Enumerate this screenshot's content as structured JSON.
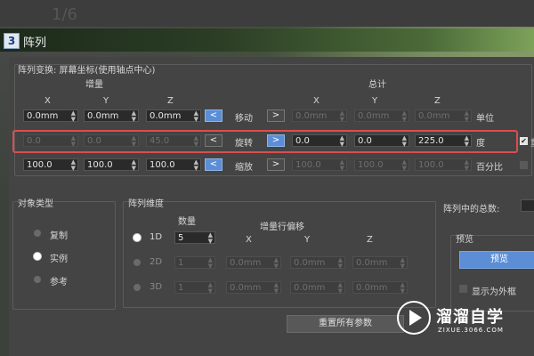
{
  "top": {
    "page_num": "1/6"
  },
  "window": {
    "icon_text": "3",
    "title": "阵列"
  },
  "transform": {
    "group_label": "阵列变换: 屏幕坐标(使用轴点中心)",
    "increment_label": "增量",
    "total_label": "总计",
    "axes": [
      "X",
      "Y",
      "Z"
    ],
    "rows": [
      {
        "name": "move",
        "label": "移动",
        "unit": "单位",
        "inc": [
          "0.0mm",
          "0.0mm",
          "0.0mm"
        ],
        "inc_enabled": true,
        "left_active": true,
        "right_active": false,
        "total": [
          "0.0mm",
          "0.0mm",
          "0.0mm"
        ],
        "total_enabled": false,
        "btn_left": "<",
        "btn_right": ">"
      },
      {
        "name": "rotate",
        "label": "旋转",
        "unit": "度",
        "check_label": "重",
        "inc": [
          "0.0",
          "0.0",
          "45.0"
        ],
        "inc_enabled": false,
        "left_active": false,
        "right_active": true,
        "total": [
          "0.0",
          "0.0",
          "225.0"
        ],
        "total_enabled": true,
        "btn_left": "<",
        "btn_right": ">"
      },
      {
        "name": "scale",
        "label": "缩放",
        "unit": "百分比",
        "inc": [
          "100.0",
          "100.0",
          "100.0"
        ],
        "inc_enabled": true,
        "left_active": true,
        "right_active": false,
        "total": [
          "100.0",
          "100.0",
          "100.0"
        ],
        "total_enabled": false,
        "btn_left": "<",
        "btn_right": ">"
      }
    ]
  },
  "object_type": {
    "label": "对象类型",
    "options": [
      "复制",
      "实例",
      "参考"
    ],
    "selected": 1
  },
  "dimensions": {
    "label": "阵列维度",
    "count_label": "数量",
    "offset_label": "增量行偏移",
    "axes": [
      "X",
      "Y",
      "Z"
    ],
    "rows": [
      {
        "label": "1D",
        "count": "5",
        "enabled": true,
        "offsets": []
      },
      {
        "label": "2D",
        "count": "1",
        "enabled": false,
        "offsets": [
          "0.0mm",
          "0.0mm",
          "0.0mm"
        ]
      },
      {
        "label": "3D",
        "count": "1",
        "enabled": false,
        "offsets": [
          "0.0mm",
          "0.0mm",
          "0.0mm"
        ]
      }
    ],
    "selected": 0
  },
  "total_in_array": {
    "label": "阵列中的总数:"
  },
  "preview": {
    "label": "预览",
    "button": "预览",
    "show_as_box": "显示为外框"
  },
  "reset_button": "重置所有参数",
  "watermark": {
    "brand": "溜溜自学",
    "url": "ZIXUE.3066.COM"
  }
}
